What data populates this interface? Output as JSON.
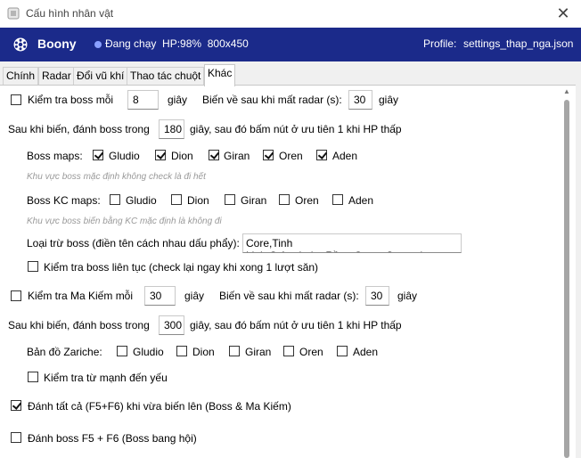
{
  "window": {
    "title": "Cấu hình nhân vật",
    "close_glyph": "✕"
  },
  "header": {
    "name": "Boony",
    "status": "Đang chạy",
    "hp": "HP:98%",
    "resolution": "800x450",
    "profile_label": "Profile:",
    "profile_value": "settings_thap_nga.json",
    "accent": "#1b2a8a"
  },
  "tabs": [
    "Chính",
    "Radar",
    "Đổi vũ khí",
    "Thao tác chuột",
    "Khác"
  ],
  "active_tab": "Khác",
  "boss": {
    "check_label": "Kiểm tra boss mỗi",
    "check_value": "8",
    "seconds": "giây",
    "return_label": "Biến về sau khi mất radar (s):",
    "return_value": "30",
    "after_label": "Sau khi biến, đánh boss trong",
    "after_value": "180",
    "after_suffix": "giây, sau đó bấm nút ở ưu tiên 1 khi HP thấp",
    "maps_label": "Boss maps:",
    "maps": [
      "Gludio",
      "Dion",
      "Giran",
      "Oren",
      "Aden"
    ],
    "maps_hint": "Khu vực boss mặc định không check là đi hết",
    "kc_label": "Boss KC maps:",
    "kc_hint": "Khu vực boss biến bằng KC mặc định là không đi",
    "exclude_label": "Loại trừ boss (điền tên cách nhau dấu phẩy):",
    "exclude_value": "Core,Tinh Linh,Orfen,Laha,Rồng,Corun,Samuel",
    "continuous_label": "Kiểm tra boss liên tục (check lại ngay khi xong 1 lượt săn)"
  },
  "ma_kiem": {
    "check_label": "Kiểm tra Ma Kiếm mỗi",
    "check_value": "30",
    "seconds": "giây",
    "return_label": "Biến về sau khi mất radar (s):",
    "return_value": "30",
    "after_label": "Sau khi biến, đánh boss trong",
    "after_value": "300",
    "after_suffix": "giây, sau đó bấm nút ở ưu tiên 1 khi HP thấp",
    "zariche_label": "Bản đồ Zariche:",
    "strong_weak_label": "Kiểm tra từ mạnh đến yếu"
  },
  "attack_all_label": "Đánh tất cả (F5+F6) khi vừa biến lên (Boss & Ma Kiếm)",
  "clan_boss_label": "Đánh boss F5 + F6 (Boss bang hội)"
}
